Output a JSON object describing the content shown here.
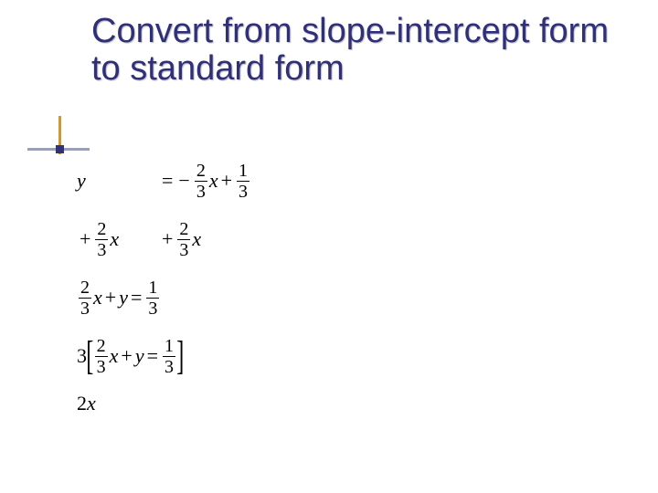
{
  "title": "Convert from slope-intercept form to standard form",
  "math": {
    "row1": {
      "lhs": "y",
      "eq": "=",
      "neg": "−",
      "f1n": "2",
      "f1d": "3",
      "x1": "x",
      "plus": "+",
      "f2n": "1",
      "f2d": "3"
    },
    "row2": {
      "lplus": "+",
      "lf_n": "2",
      "lf_d": "3",
      "lx": "x",
      "rplus": "+",
      "rf_n": "2",
      "rf_d": "3",
      "rx": "x"
    },
    "row3": {
      "fn": "2",
      "fd": "3",
      "x": "x",
      "plus": "+",
      "y": "y",
      "eq": "=",
      "rn": "1",
      "rd": "3"
    },
    "row4": {
      "three": "3",
      "lb": "[",
      "fn": "2",
      "fd": "3",
      "x": "x",
      "plus": "+",
      "y": "y",
      "eq": "=",
      "rn": "1",
      "rd": "3",
      "rb": "]"
    },
    "row5": {
      "two": "2",
      "x": "x"
    }
  }
}
